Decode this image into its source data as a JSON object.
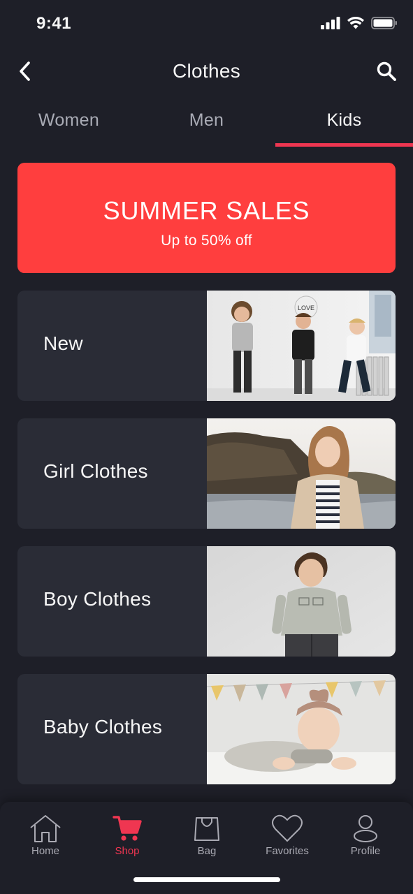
{
  "status": {
    "time": "9:41"
  },
  "header": {
    "title": "Clothes"
  },
  "tabs": [
    {
      "label": "Women",
      "active": false
    },
    {
      "label": "Men",
      "active": false
    },
    {
      "label": "Kids",
      "active": true
    }
  ],
  "banner": {
    "title": "SUMMER SALES",
    "subtitle": "Up to 50% off",
    "color": "#ff3e3e"
  },
  "categories": [
    {
      "label": "New",
      "image": "kids-group-photo"
    },
    {
      "label": "Girl Clothes",
      "image": "girl-photo"
    },
    {
      "label": "Boy Clothes",
      "image": "boy-photo"
    },
    {
      "label": "Baby Clothes",
      "image": "baby-photo"
    }
  ],
  "image_text": {
    "balloon": "LOVE"
  },
  "nav": [
    {
      "label": "Home",
      "icon": "home-icon",
      "active": false
    },
    {
      "label": "Shop",
      "icon": "cart-icon",
      "active": true
    },
    {
      "label": "Bag",
      "icon": "bag-icon",
      "active": false
    },
    {
      "label": "Favorites",
      "icon": "heart-icon",
      "active": false
    },
    {
      "label": "Profile",
      "icon": "profile-icon",
      "active": false
    }
  ],
  "colors": {
    "background": "#1e1f28",
    "card": "#2a2c36",
    "accent": "#ef3651",
    "text": "#f6f6f6",
    "muted": "#aaaab3"
  }
}
